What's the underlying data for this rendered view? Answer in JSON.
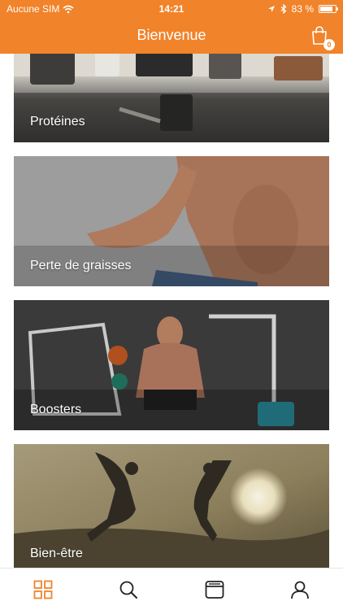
{
  "status_bar": {
    "carrier": "Aucune SIM",
    "time": "14:21",
    "battery_text": "83 %",
    "battery_level": 0.83
  },
  "header": {
    "title": "Bienvenue",
    "cart_count": "0",
    "accent_color": "#f1832a"
  },
  "categories": [
    {
      "label": "Protéines",
      "image": "supplements-photo"
    },
    {
      "label": "Perte de graisses",
      "image": "abs-torso-photo"
    },
    {
      "label": "Boosters",
      "image": "gym-workout-photo"
    },
    {
      "label": "Bien-être",
      "image": "jumping-sunset-photo"
    }
  ],
  "tabbar": {
    "tabs": [
      {
        "icon": "grid-icon",
        "active": true
      },
      {
        "icon": "search-icon",
        "active": false
      },
      {
        "icon": "browser-icon",
        "active": false
      },
      {
        "icon": "user-icon",
        "active": false
      }
    ],
    "active_color": "#f1832a",
    "inactive_color": "#222222"
  }
}
